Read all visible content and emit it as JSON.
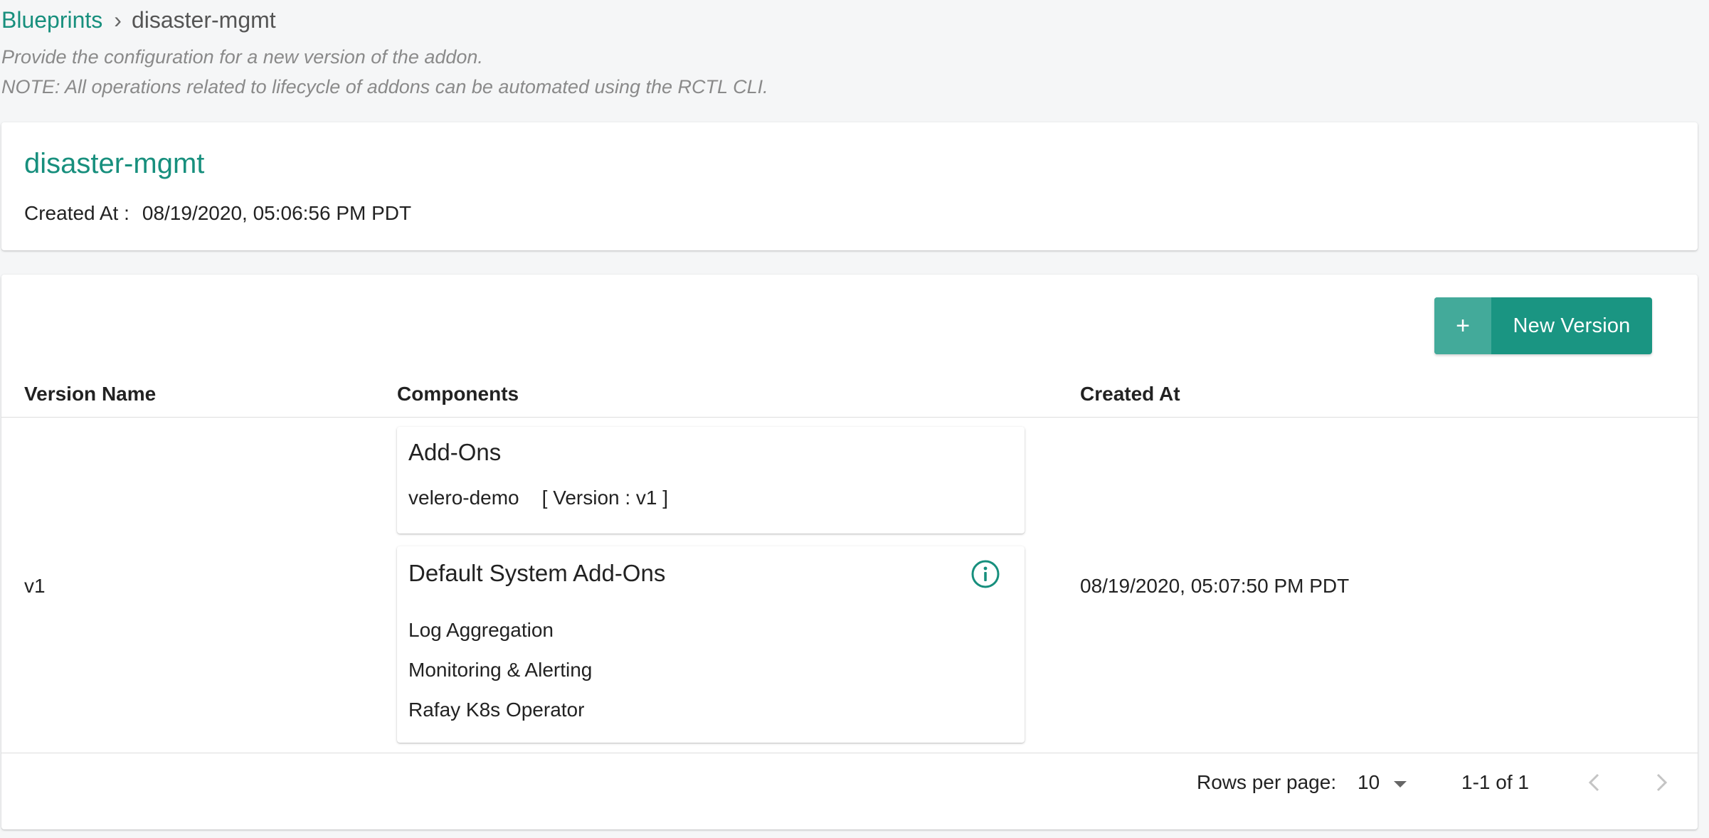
{
  "breadcrumb": {
    "root": "Blueprints",
    "separator": "›",
    "current": "disaster-mgmt"
  },
  "subtitle": {
    "line1": "Provide the configuration for a new version of the addon.",
    "line2": "NOTE: All operations related to lifecycle of addons can be automated using the RCTL CLI."
  },
  "blueprint": {
    "name": "disaster-mgmt",
    "created_label": "Created At :",
    "created_value": "08/19/2020, 05:06:56 PM PDT"
  },
  "toolbar": {
    "new_version_icon": "+",
    "new_version_label": "New Version"
  },
  "table": {
    "columns": [
      "Version Name",
      "Components",
      "Created At"
    ],
    "rows": [
      {
        "version": "v1",
        "addons": {
          "title": "Add-Ons",
          "items": [
            {
              "name": "velero-demo",
              "version": "[ Version : v1 ]"
            }
          ]
        },
        "system_addons": {
          "title": "Default System Add-Ons",
          "icon": "info-icon",
          "items": [
            "Log Aggregation",
            "Monitoring & Alerting",
            "Rafay K8s Operator"
          ]
        },
        "created_at": "08/19/2020, 05:07:50 PM PDT"
      }
    ]
  },
  "pagination": {
    "rows_per_page_label": "Rows per page:",
    "rows_per_page_value": "10",
    "range": "1-1 of 1"
  },
  "colors": {
    "accent": "#178f7d",
    "button": "#1a9582",
    "button_icon_bg": "#43aa9a"
  }
}
